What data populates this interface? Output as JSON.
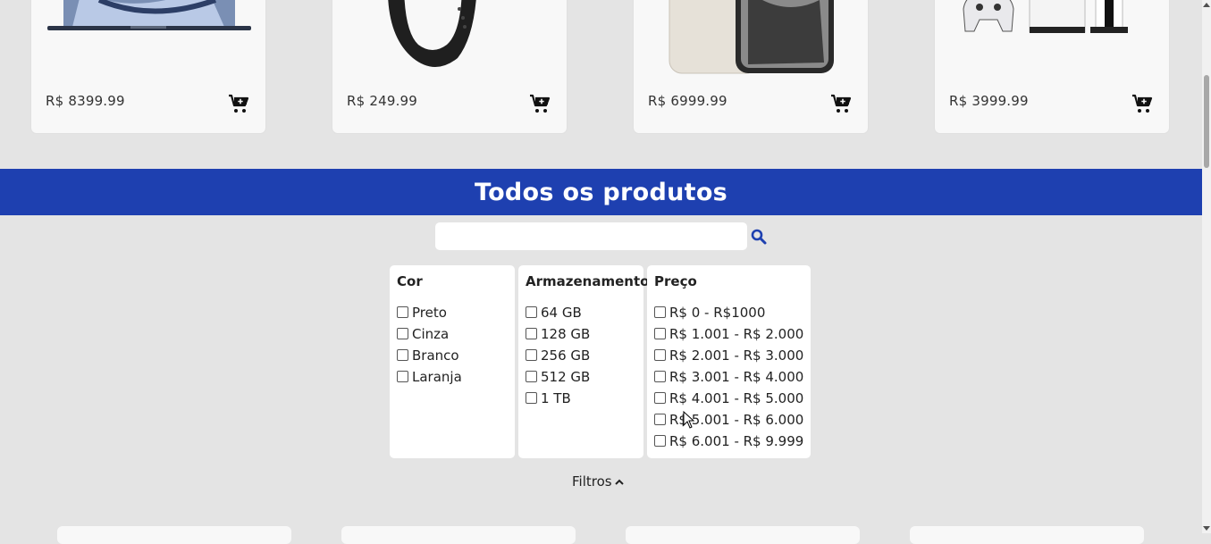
{
  "featured_products": [
    {
      "price": "R$ 8399.99",
      "image_icon": "laptop-image"
    },
    {
      "price": "R$ 249.99",
      "image_icon": "smartwatch-band-image"
    },
    {
      "price": "R$ 6999.99",
      "image_icon": "smartphone-image"
    },
    {
      "price": "R$ 3999.99",
      "image_icon": "game-console-image"
    }
  ],
  "section": {
    "title": "Todos os produtos"
  },
  "search": {
    "value": "",
    "placeholder": "",
    "icon": "search-icon"
  },
  "filters": {
    "cor": {
      "title": "Cor",
      "options": [
        "Preto",
        "Cinza",
        "Branco",
        "Laranja"
      ]
    },
    "armazenamento": {
      "title": "Armazenamento",
      "options": [
        "64 GB",
        "128 GB",
        "256 GB",
        "512 GB",
        "1 TB"
      ]
    },
    "preco": {
      "title": "Preço",
      "options": [
        "R$ 0 - R$1000",
        "R$ 1.001 - R$ 2.000",
        "R$ 2.001 - R$ 3.000",
        "R$ 3.001 - R$ 4.000",
        "R$ 4.001 - R$ 5.000",
        "R$ 5.001 - R$ 6.000",
        "R$ 6.001 - R$ 9.999"
      ]
    },
    "toggle_label": "Filtros"
  },
  "colors": {
    "accent": "#1e40b0",
    "background": "#e4e4e4",
    "card": "#f8f8f8"
  }
}
